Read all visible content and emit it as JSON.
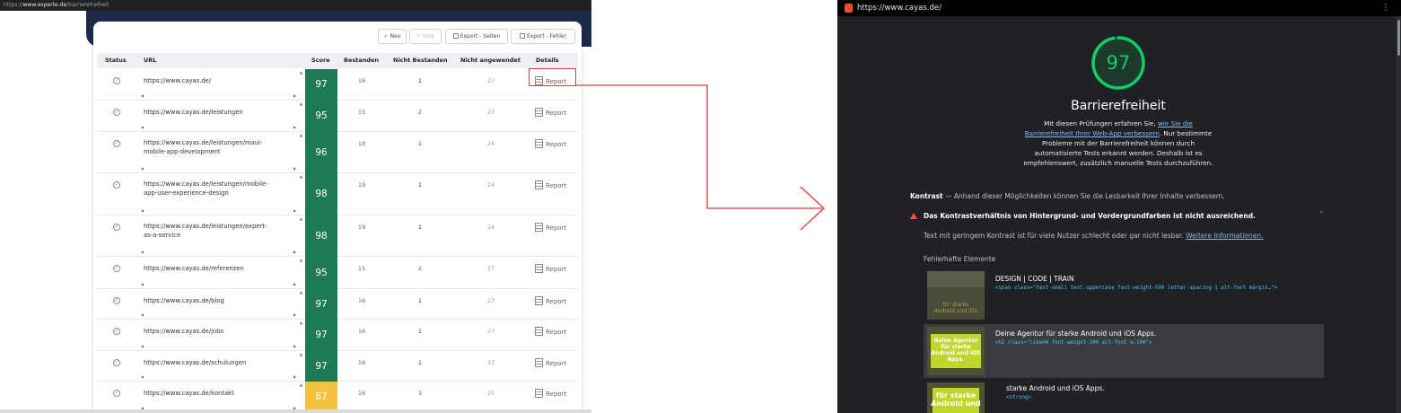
{
  "left": {
    "url_bar": {
      "prefix": "https://",
      "host": "www.experte.de",
      "path": "/barrierefreiheit"
    },
    "toolbar": {
      "new_label": "Neu",
      "stop_label": "Stop",
      "export_pages_label": "Export - Seiten",
      "export_errors_label": "Export - Fehler"
    },
    "columns": {
      "status": "Status",
      "url": "URL",
      "score": "Score",
      "passed": "Bestanden",
      "failed": "Nicht Bestanden",
      "not_applied": "Nicht angewendet",
      "details": "Details"
    },
    "report_label": "Report",
    "rows": [
      {
        "url_line1": "https://www.cayas.de/",
        "url_line2": "",
        "score": "97",
        "passed": "16",
        "failed": "1",
        "not_applied": "27"
      },
      {
        "url_line1": "https://www.cayas.de/leistungen",
        "url_line2": "",
        "score": "95",
        "passed": "15",
        "failed": "2",
        "not_applied": "27"
      },
      {
        "url_line1": "https://www.cayas.de/leistungen/maui-",
        "url_line2": "mobile-app-development",
        "score": "96",
        "passed": "18",
        "failed": "2",
        "not_applied": "24"
      },
      {
        "url_line1": "https://www.cayas.de/leistungen/mobile-",
        "url_line2": "app-user-experience-design",
        "score": "98",
        "passed": "19",
        "failed": "1",
        "not_applied": "24"
      },
      {
        "url_line1": "https://www.cayas.de/leistungen/expert-",
        "url_line2": "as-a-service",
        "score": "98",
        "passed": "19",
        "failed": "1",
        "not_applied": "24"
      },
      {
        "url_line1": "https://www.cayas.de/referenzen",
        "url_line2": "",
        "score": "95",
        "passed": "15",
        "failed": "2",
        "not_applied": "27"
      },
      {
        "url_line1": "https://www.cayas.de/blog",
        "url_line2": "",
        "score": "97",
        "passed": "16",
        "failed": "1",
        "not_applied": "27"
      },
      {
        "url_line1": "https://www.cayas.de/jobs",
        "url_line2": "",
        "score": "97",
        "passed": "16",
        "failed": "1",
        "not_applied": "27"
      },
      {
        "url_line1": "https://www.cayas.de/schulungen",
        "url_line2": "",
        "score": "97",
        "passed": "16",
        "failed": "1",
        "not_applied": "27"
      },
      {
        "url_line1": "https://www.cayas.de/kontakt",
        "url_line2": "",
        "score": "87",
        "passed": "16",
        "failed": "3",
        "not_applied": "25"
      }
    ]
  },
  "right": {
    "url": "https://www.cayas.de/",
    "score": "97",
    "score_fraction": 0.97,
    "title": "Barrierefreiheit",
    "desc_part1": "Mit diesen Prüfungen erfahren Sie, ",
    "desc_link": "wie Sie die Barrierefreiheit Ihrer Web-App verbessern",
    "desc_part2": ". Nur bestimmte Probleme mit der Barrierefreiheit können durch automatisierte Tests erkannt werden. Deshalb ist es empfehlenswert, zusätzlich manuelle Tests durchzuführen.",
    "section_name": "Kontrast",
    "section_desc": " — Anhand dieser Möglichkeiten können Sie die Lesbarkeit Ihrer Inhalte verbessern.",
    "audit_title": "Das Kontrastverhältnis von Hintergrund- und Vordergrundfarben ist nicht ausreichend.",
    "audit_desc": "Text mit geringem Kontrast ist für viele Nutzer schlecht oder gar nicht lesbar. ",
    "audit_link": "Weitere Informationen.",
    "elements_label": "Fehlerhafte Elemente",
    "elements": [
      {
        "title": "DESIGN | CODE | TRAIN",
        "code": "<span class=\"text-small text-uppercase font-weight-500 letter-spacing-1 alt-font margin…\">",
        "thumb_line1": "für starke",
        "thumb_line2": "Android und iOS"
      },
      {
        "title": "Deine Agentur für starke Android und iOS Apps.",
        "code": "<h2 class=\"likeH4 font-weight-300 alt-font w-100\">",
        "thumb_line1": "Deine Agentur für starke",
        "thumb_line2": "Android und iOS Apps."
      },
      {
        "title": "starke Android und iOS Apps.",
        "code": "<strong>",
        "thumb_line1": "für starke",
        "thumb_line2": "Android und"
      }
    ],
    "colors": {
      "gauge_green": "#0cce6b",
      "fail_red": "#ff4e42",
      "link_blue": "#8ab4f8",
      "code_cyan": "#4fc3f7"
    }
  },
  "colors": {
    "score_green": "#1e7a55",
    "score_yellow": "#f6c23e",
    "highlight_red": "#e53935"
  }
}
